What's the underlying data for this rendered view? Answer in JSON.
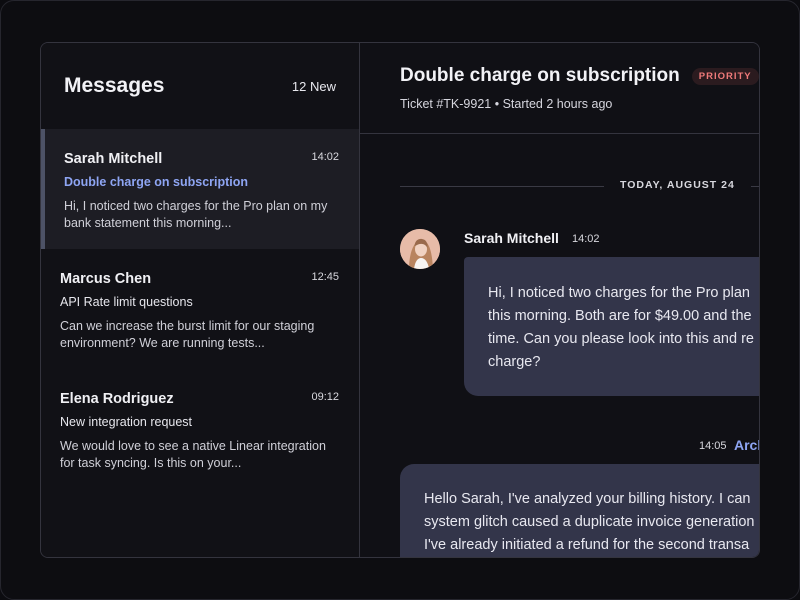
{
  "sidebar": {
    "title": "Messages",
    "new_count": "12 New",
    "items": [
      {
        "name": "Sarah Mitchell",
        "time": "14:02",
        "subject": "Double charge on subscription",
        "preview_line1": "Hi, I noticed two charges for the Pro plan on my",
        "preview_line2": "bank statement this morning...",
        "active": true
      },
      {
        "name": "Marcus Chen",
        "time": "12:45",
        "subject": "API Rate limit questions",
        "preview_line1": "Can we increase the burst limit for our staging",
        "preview_line2": "environment? We are running tests...",
        "active": false
      },
      {
        "name": "Elena Rodriguez",
        "time": "09:12",
        "subject": "New integration request",
        "preview_line1": "We would love to see a native Linear integration",
        "preview_line2": "for task syncing. Is this on your...",
        "active": false
      }
    ]
  },
  "ticket": {
    "title": "Double charge on subscription",
    "badge": "PRIORITY",
    "meta": "Ticket #TK-9921 • Started 2 hours ago"
  },
  "thread": {
    "date_label": "TODAY, AUGUST 24",
    "messages": [
      {
        "author": "Sarah Mitchell",
        "time": "14:02",
        "lines": [
          "Hi, I noticed two charges for the Pro plan",
          "this morning. Both are for $49.00 and the",
          "time. Can you please look into this and re",
          "charge?"
        ]
      },
      {
        "author": "Arch",
        "time": "14:05",
        "lines": [
          "Hello Sarah, I've analyzed your billing history. I can",
          "system glitch caused a duplicate invoice generation",
          "I've already initiated a refund for the second transa"
        ]
      }
    ]
  },
  "colors": {
    "accent": "#8ea5f3",
    "priority": "#f07a7a",
    "bubble": "#33354a"
  }
}
